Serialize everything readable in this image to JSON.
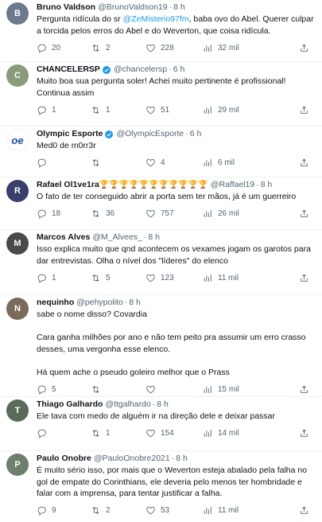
{
  "tweets": [
    {
      "name": "Bruno Valdson",
      "handle": "@BrunoValdson19",
      "time": "8 h",
      "verified": false,
      "avatar_color": "#6b7a8f",
      "text_pre": "Pergunta ridícula do sr ",
      "mention": "@ZeMisterio97fm",
      "text_post": ", baba ovo do Abel. Querer culpar a torcida pelos erros do Abel e do Weverton, que coisa ridícula.",
      "replies": "20",
      "retweets": "2",
      "likes": "228",
      "views": "32 mil"
    },
    {
      "name": "CHANCELERSP",
      "handle": "@chancelersp",
      "time": "6 h",
      "verified": true,
      "avatar_color": "#8a9a7b",
      "text": "Muito boa sua pergunta soler! Achei muito pertinente é profissional!\nContinua assim",
      "replies": "1",
      "retweets": "1",
      "likes": "51",
      "views": "29 mil"
    },
    {
      "name": "Olympic Esporte",
      "handle": "@OlympicEsporte",
      "time": "6 h",
      "verified": true,
      "avatar_color": "#ffffff",
      "avatar_logo": "oe",
      "text": "Med0 de m0rr3r",
      "replies": "",
      "retweets": "",
      "likes": "4",
      "views": "6 mil"
    },
    {
      "name": "Rafael Ol1ve1ra",
      "handle": "@Raffael19",
      "time": "8 h",
      "verified": false,
      "avatar_color": "#3a3f6b",
      "name_emoji": "🏆🏆🏆🏆🏆🏆🏆🏆🏆🏆🏆",
      "text": "O fato de ter conseguido abrir a porta sem ter mãos, já é um guerreiro",
      "replies": "18",
      "retweets": "36",
      "likes": "757",
      "views": "26 mil"
    },
    {
      "name": "Marcos Alves",
      "handle": "@M_Alvees_",
      "time": "8 h",
      "verified": false,
      "avatar_color": "#4a4a4a",
      "text": "Isso explica muito que qnd acontecem os vexames jogam os garotos para dar entrevistas. Olha o nível dos \"líderes\" do elenco",
      "replies": "1",
      "retweets": "5",
      "likes": "123",
      "views": "11 mil"
    },
    {
      "name": "nequinho",
      "handle": "@pehypolito",
      "time": "8 h",
      "verified": false,
      "avatar_color": "#7a6a5a",
      "text": "sabe o nome disso? Covardia\n\nCara ganha milhões por ano e não tem peito pra assumir um erro crasso desses, uma vergonha esse elenco.\n\nHá quem ache o pseudo goleiro melhor que o Prass",
      "replies": "5",
      "retweets": "",
      "likes": "",
      "views": "15 mil"
    },
    {
      "name": "Thiago Galhardo",
      "handle": "@ttgalhardo",
      "time": "8 h",
      "verified": false,
      "avatar_color": "#5b6b5b",
      "text": "Ele tava com medo de alguém ir na direção dele e deixar passar",
      "replies": "",
      "retweets": "1",
      "likes": "154",
      "views": "14 mil"
    },
    {
      "name": "Paulo Onobre",
      "handle": "@PauloOnobre2021",
      "time": "8 h",
      "verified": false,
      "avatar_color": "#6d7f6d",
      "text": "É muito sério isso, por mais que o Weverton esteja abalado pela falha no gol de empate do Corinthians, ele deveria pelo menos ter hombridade e falar com a imprensa, para tentar justificar a falha.",
      "replies": "9",
      "retweets": "2",
      "likes": "53",
      "views": "11 mil"
    }
  ],
  "icons": {
    "reply": "reply-icon",
    "retweet": "retweet-icon",
    "like": "heart-icon",
    "views": "views-icon",
    "share": "share-icon"
  },
  "colors": {
    "link": "#1d9bf0",
    "verified": "#1d9bf0",
    "muted": "#536471"
  }
}
